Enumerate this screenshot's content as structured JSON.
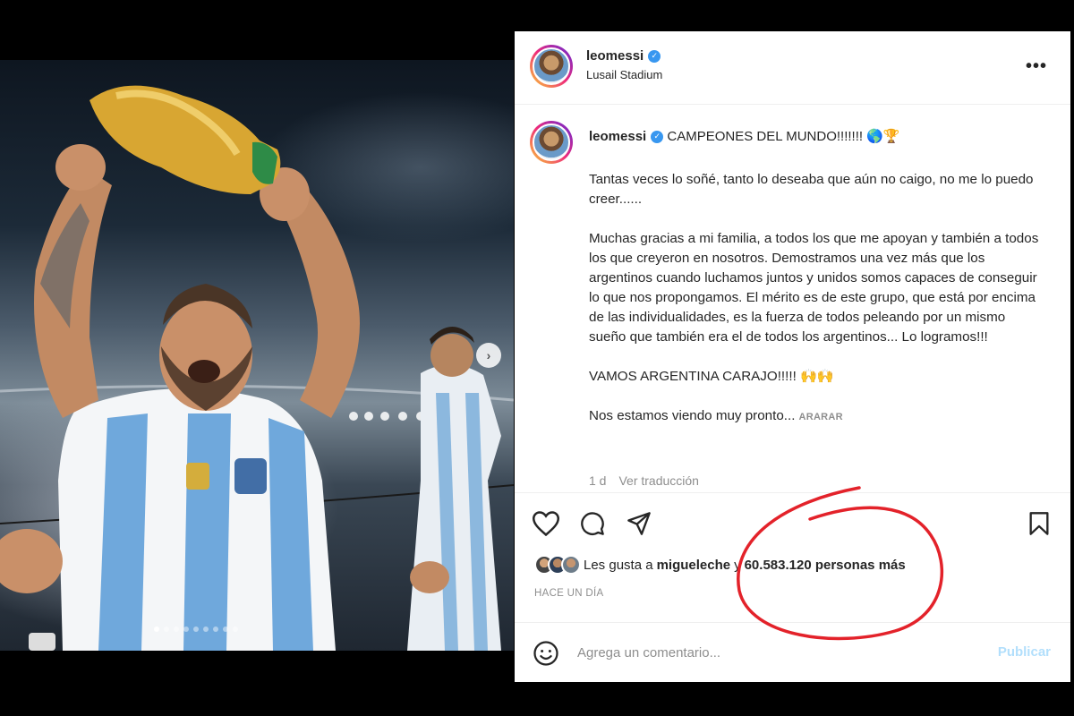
{
  "post": {
    "username": "leomessi",
    "location": "Lusail Stadium",
    "verified_glyph": "✓",
    "more_glyph": "•••",
    "caption": {
      "username": "leomessi",
      "headline": "CAMPEONES DEL MUNDO!!!!!!! 🌎🏆",
      "paragraphs": [
        "Tantas veces lo soñé, tanto lo deseaba que aún no caigo, no me lo puedo creer......",
        "Muchas gracias a mi familia, a todos los que me apoyan y también a todos los que creyeron en nosotros. Demostramos una vez más que los argentinos cuando luchamos juntos y unidos somos capaces de conseguir lo que nos propongamos. El mérito es de este grupo, que está por encima de las individualidades, es la fuerza de todos peleando por un mismo sueño que también era el de todos los argentinos... Lo logramos!!!",
        "VAMOS ARGENTINA CARAJO!!!!! 🙌🙌"
      ],
      "last_line": "Nos estamos viendo muy pronto...",
      "more_label": "ARARAR",
      "age": "1 d",
      "translate_label": "Ver traducción"
    },
    "likes": {
      "prefix": "Les gusta a",
      "user": "migueleche",
      "connector": "y",
      "count_text": "60.583.120 personas más"
    },
    "time_ago": "HACE UN DÍA",
    "comment": {
      "placeholder": "Agrega un comentario...",
      "value": "",
      "submit_label": "Publicar"
    }
  },
  "carousel": {
    "dots_total": 9,
    "active_index": 0,
    "next_glyph": "›"
  },
  "icons": {
    "like": "heart-icon",
    "comment": "comment-icon",
    "share": "share-icon",
    "save": "bookmark-icon",
    "emoji": "emoji-icon"
  },
  "colors": {
    "verified": "#3897f0",
    "publish_disabled": "#b2dffc",
    "annotation": "#e3222a"
  }
}
